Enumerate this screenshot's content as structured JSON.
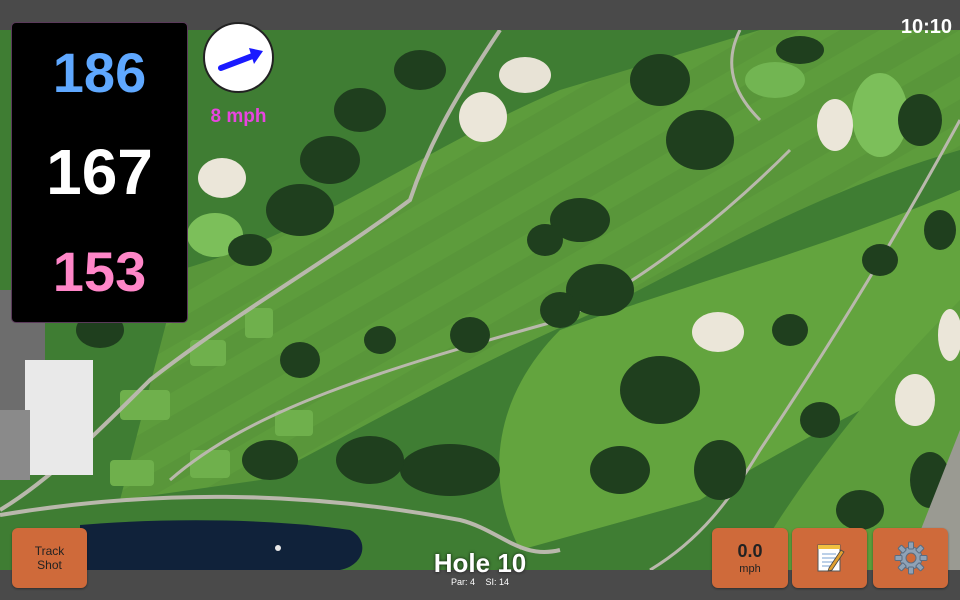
{
  "status": {
    "time": "10:10"
  },
  "distances": {
    "back": "186",
    "middle": "167",
    "front": "153"
  },
  "wind": {
    "speed_label": "8 mph",
    "direction_icon": "arrow-east-northeast-icon"
  },
  "buttons": {
    "track_shot_line1": "Track",
    "track_shot_line2": "Shot",
    "wind_value": "0.0",
    "wind_unit": "mph",
    "notes_icon": "notepad-icon",
    "settings_icon": "gear-icon"
  },
  "hole": {
    "title": "Hole 10",
    "par": "Par: 4",
    "si": "SI: 14"
  },
  "colors": {
    "back_distance": "#5fa8ff",
    "middle_distance": "#ffffff",
    "front_distance": "#ff86c8",
    "wind_speed": "#e845e0",
    "button_bg": "#cf6a3a",
    "arrow": "#1a1aff"
  }
}
